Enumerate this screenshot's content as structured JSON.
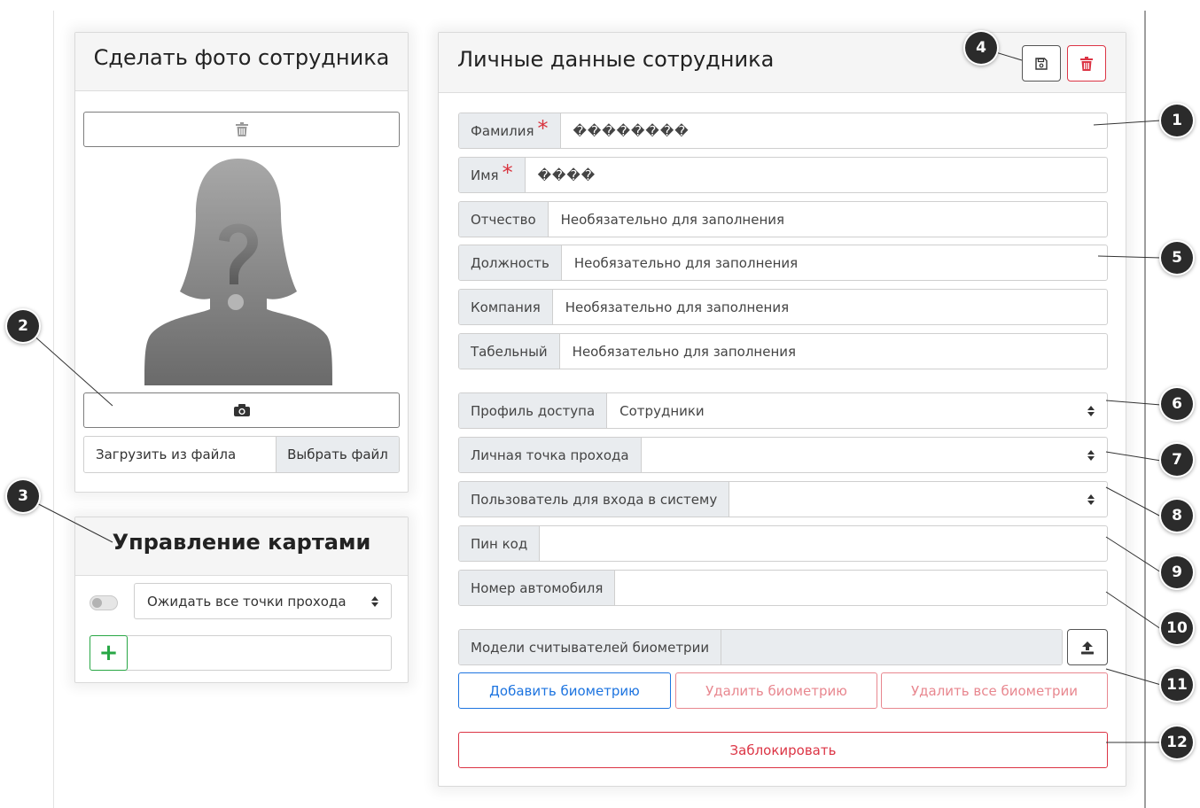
{
  "photo_panel": {
    "title": "Сделать фото сотрудника",
    "upload_placeholder": "Загрузить из файла",
    "choose_file_label": "Выбрать файл"
  },
  "cards_panel": {
    "title": "Управление картами",
    "wait_select_value": "Ожидать все точки прохода",
    "add_symbol": "+"
  },
  "personal_panel": {
    "title": "Личные данные сотрудника",
    "fields": {
      "last_name": {
        "label": "Фамилия",
        "required": "*",
        "value": "��������"
      },
      "first_name": {
        "label": "Имя",
        "required": "*",
        "value": "����"
      },
      "patronymic": {
        "label": "Отчество",
        "placeholder": "Необязательно для заполнения"
      },
      "position": {
        "label": "Должность",
        "placeholder": "Необязательно для заполнения"
      },
      "company": {
        "label": "Компания",
        "placeholder": "Необязательно для заполнения"
      },
      "tab_number": {
        "label": "Табельный",
        "placeholder": "Необязательно для заполнения"
      },
      "access_profile": {
        "label": "Профиль доступа",
        "value": "Сотрудники"
      },
      "personal_point": {
        "label": "Личная точка прохода",
        "value": ""
      },
      "login_user": {
        "label": "Пользователь для входа в систему",
        "value": ""
      },
      "pin": {
        "label": "Пин код",
        "value": ""
      },
      "car_number": {
        "label": "Номер автомобиля",
        "value": ""
      },
      "biometry_models": {
        "label": "Модели считывателей биометрии"
      }
    },
    "buttons": {
      "add_biometry": "Добавить биометрию",
      "delete_biometry": "Удалить биометрию",
      "delete_all_biometry": "Удалить все биометрии",
      "block": "Заблокировать"
    }
  },
  "callouts": [
    "1",
    "2",
    "3",
    "4",
    "5",
    "6",
    "7",
    "8",
    "9",
    "10",
    "11",
    "12"
  ],
  "colors": {
    "danger": "#dc3545",
    "primary": "#1d74e0",
    "success": "#28a745",
    "callout_bg": "#2b2b2b",
    "addon_bg": "#e9ecef"
  },
  "icons": {
    "photo_clear": "trash-icon",
    "photo_capture": "camera-icon",
    "save": "floppy-disk-icon",
    "delete": "trash-icon",
    "upload": "upload-icon",
    "select": "sort-caret-icon"
  }
}
